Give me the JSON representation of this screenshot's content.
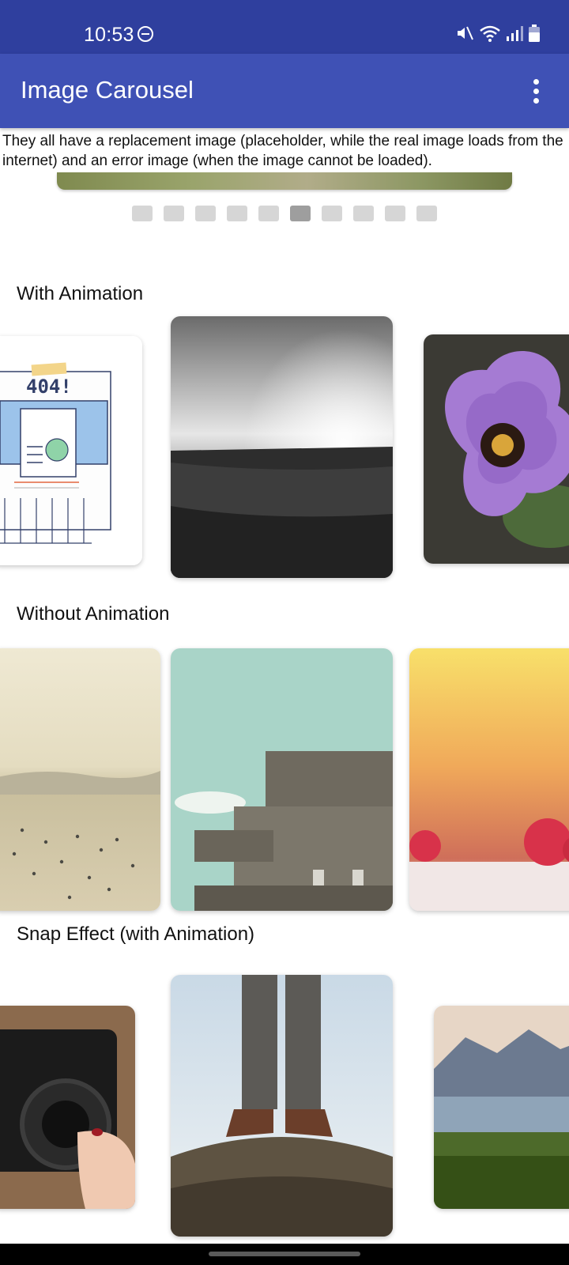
{
  "status_bar": {
    "time": "10:53",
    "icons": [
      "do-not-disturb-icon",
      "mute-icon",
      "wifi-icon",
      "signal-icon",
      "battery-icon"
    ]
  },
  "app_bar": {
    "title": "Image Carousel",
    "menu_icon": "more-vert-icon"
  },
  "description": "They all have a replacement image (placeholder, while the real image loads from the internet) and an error image (when the image cannot be loaded).",
  "indicator": {
    "count": 10,
    "active_index": 5
  },
  "sections": {
    "with_animation": {
      "title": "With Animation",
      "items": [
        "error-404-image",
        "bw-sunset-field-image",
        "purple-flower-image"
      ]
    },
    "without_animation": {
      "title": "Without Animation",
      "items": [
        "foggy-beach-image",
        "concrete-bunker-image",
        "raspberries-image"
      ]
    },
    "snap_effect": {
      "title": "Snap Effect (with Animation)",
      "items": [
        "camera-hand-image",
        "boots-rock-image",
        "lake-mountains-image"
      ]
    }
  },
  "error_image": {
    "text": "404!"
  },
  "colors": {
    "status_bar": "#2f3f9e",
    "app_bar": "#3f51b5",
    "indicator_inactive": "#d6d6d6",
    "indicator_active": "#9e9e9e"
  }
}
